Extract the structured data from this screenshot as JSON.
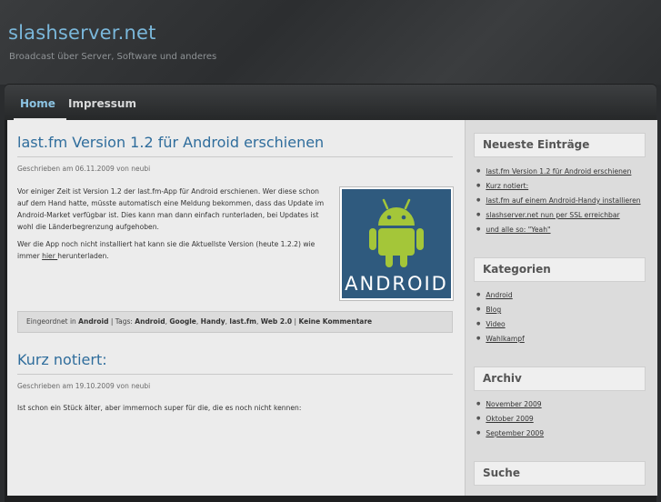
{
  "site": {
    "title": "slashserver.net",
    "description": "Broadcast über Server, Software und anderes"
  },
  "nav": {
    "items": [
      {
        "label": "Home",
        "active": true
      },
      {
        "label": "Impressum",
        "active": false
      }
    ]
  },
  "posts": [
    {
      "title": "last.fm Version 1.2 für Android erschienen",
      "meta": "Geschrieben am 06.11.2009 von neubi",
      "paragraph1": "Vor einiger Zeit ist Version 1.2 der last.fm-App für Android erschienen. Wer diese schon auf dem Hand hatte, müsste automatisch eine Meldung bekommen, dass das Update im Android-Market verfügbar ist. Dies kann man dann einfach runterladen, bei Updates ist wohl die Länderbegrenzung aufgehoben.",
      "paragraph2_before": "Wer die App noch nicht installiert hat kann sie die Aktuellste Version (heute 1.2.2) wie immer ",
      "paragraph2_link": "hier ",
      "paragraph2_after": "herunterladen.",
      "image_text": "ANDROID",
      "footer": {
        "prefix": "Eingeordnet in ",
        "category": "Android",
        "tags_prefix": " | Tags: ",
        "tags": [
          "Android",
          "Google",
          "Handy",
          "last.fm",
          "Web 2.0"
        ],
        "separator": ", ",
        "divider": " | ",
        "comments": "Keine Kommentare"
      }
    },
    {
      "title": "Kurz notiert:",
      "meta": "Geschrieben am 19.10.2009 von neubi",
      "text": "Ist schon ein Stück älter, aber immernoch super für die, die es noch nicht kennen:"
    }
  ],
  "sidebar": {
    "recent": {
      "title": "Neueste Einträge",
      "items": [
        "last.fm Version 1.2 für Android erschienen",
        "Kurz notiert:",
        "last.fm auf einem Android-Handy installieren",
        "slashserver.net nun per SSL erreichbar",
        "und alle so: \"Yeah\""
      ]
    },
    "categories": {
      "title": "Kategorien",
      "items": [
        "Android",
        "Blog",
        "Video",
        "Wahlkampf"
      ]
    },
    "archive": {
      "title": "Archiv",
      "items": [
        "November 2009",
        "Oktober 2009",
        "September 2009"
      ]
    },
    "search": {
      "title": "Suche"
    }
  },
  "colors": {
    "accent": "#7ab7da",
    "link_title": "#2f6d9c",
    "android_green": "#a4c639",
    "android_bg": "#2f5a7e"
  }
}
